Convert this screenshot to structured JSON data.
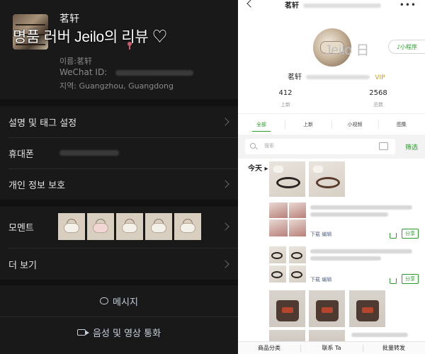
{
  "left": {
    "profile": {
      "name": "茗轩",
      "banner": "명품 러버 Jeilo의 리뷰 ♡",
      "id_label": "이름:茗轩",
      "wechat_label": "WeChat ID:",
      "region": "지역:  Guangzhou, Guangdong"
    },
    "rows": {
      "tags": "설명 및 태그 설정",
      "phone": "휴대폰",
      "privacy": "개인 정보 보호",
      "moments": "모멘트",
      "more": "더 보기"
    },
    "actions": {
      "message": "메시지",
      "call": "음성 및 영상 통화"
    }
  },
  "right": {
    "header_title": "茗轩",
    "avatar_text": "Jeilo 日",
    "mini_program": "♪小程序",
    "username": "茗轩",
    "vip": "VIP",
    "stats": [
      {
        "num": "412",
        "label": "上新"
      },
      {
        "num": "2568",
        "label": "总数"
      }
    ],
    "tabs": [
      "全部",
      "上新",
      "小视频",
      "图集"
    ],
    "search_placeholder": "搜索",
    "filter": "筛选",
    "today": "今天",
    "post_links": "下载  编辑",
    "share": "分享",
    "bottom_nav": [
      "商品分类",
      "联系 Ta",
      "批量转发"
    ]
  },
  "colors": {
    "left_bg": "#191919",
    "accent_green": "#2a9a2a",
    "vip_gold": "#c9a227"
  }
}
